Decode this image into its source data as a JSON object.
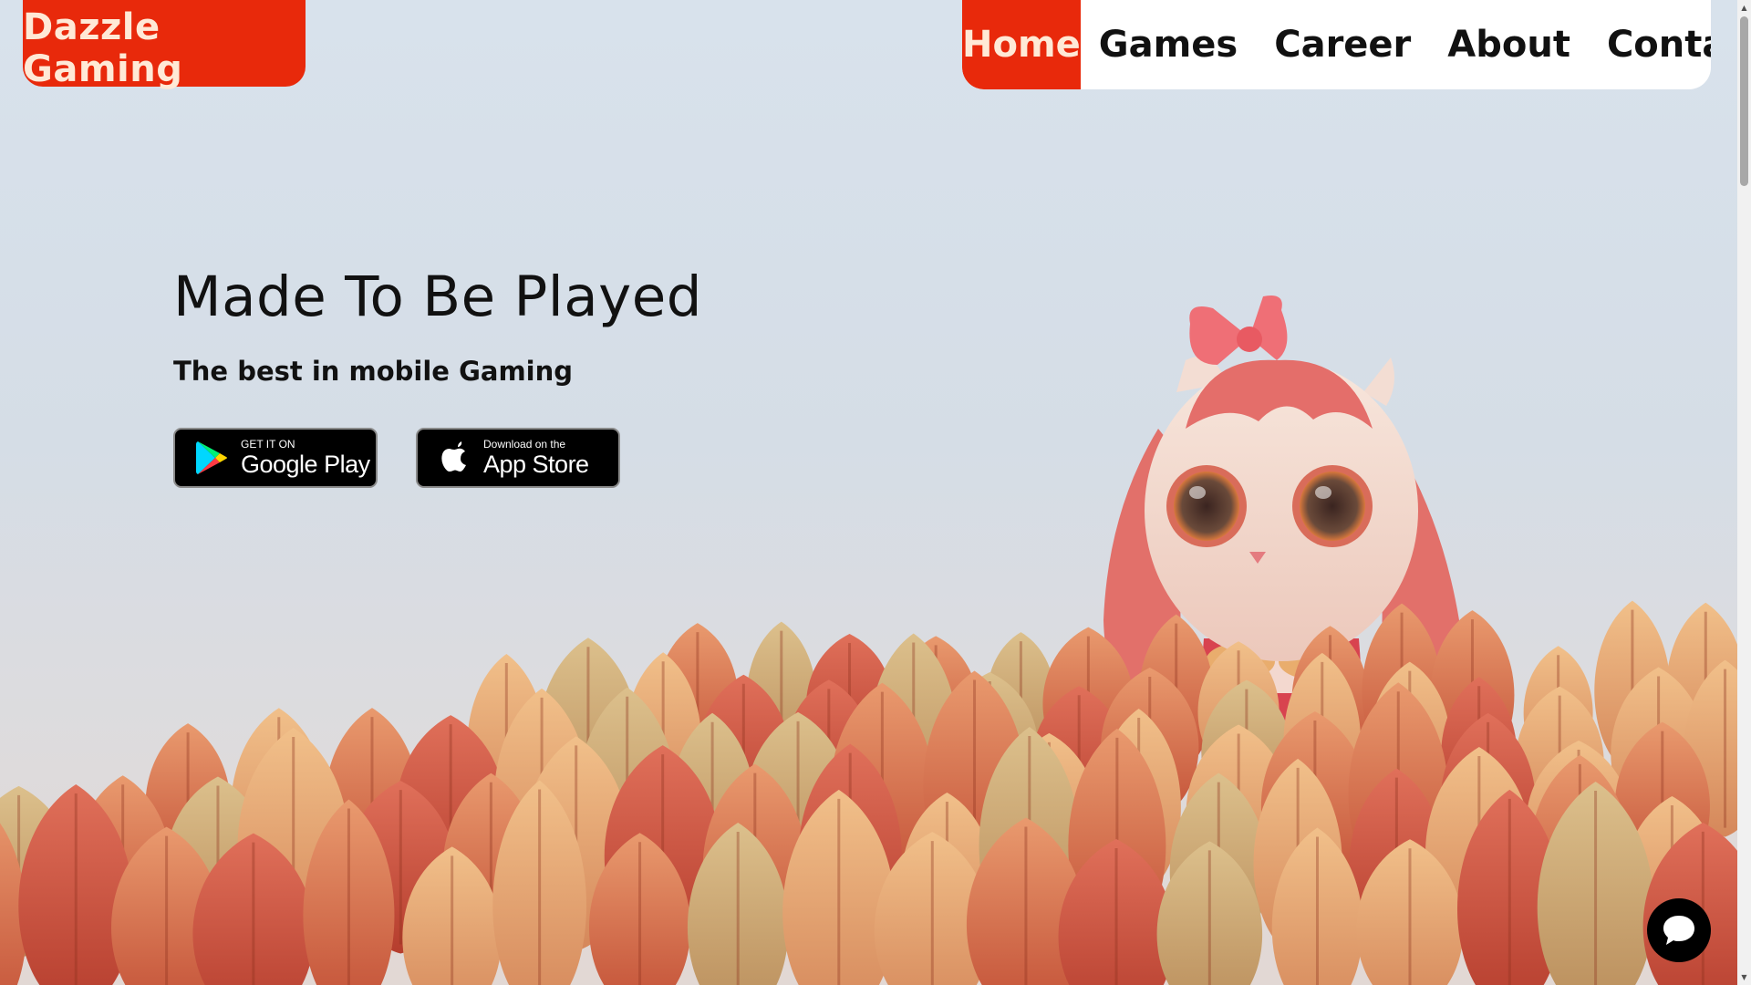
{
  "brand": {
    "logo_text": "Dazzle Gaming",
    "accent_color": "#e8290b"
  },
  "nav": {
    "items": [
      {
        "label": "Home",
        "active": true
      },
      {
        "label": "Games",
        "active": false
      },
      {
        "label": "Career",
        "active": false
      },
      {
        "label": "About",
        "active": false
      },
      {
        "label": "Contact",
        "active": false
      }
    ]
  },
  "hero": {
    "title": "Made To Be Played",
    "subtitle": "The best in mobile Gaming",
    "google_play": {
      "small": "GET IT ON",
      "big": "Google Play"
    },
    "app_store": {
      "small": "Download on the",
      "big": "App Store"
    }
  },
  "icons": {
    "google_play": "google-play-icon",
    "apple": "apple-icon",
    "chat": "chat-bubble-icon"
  }
}
